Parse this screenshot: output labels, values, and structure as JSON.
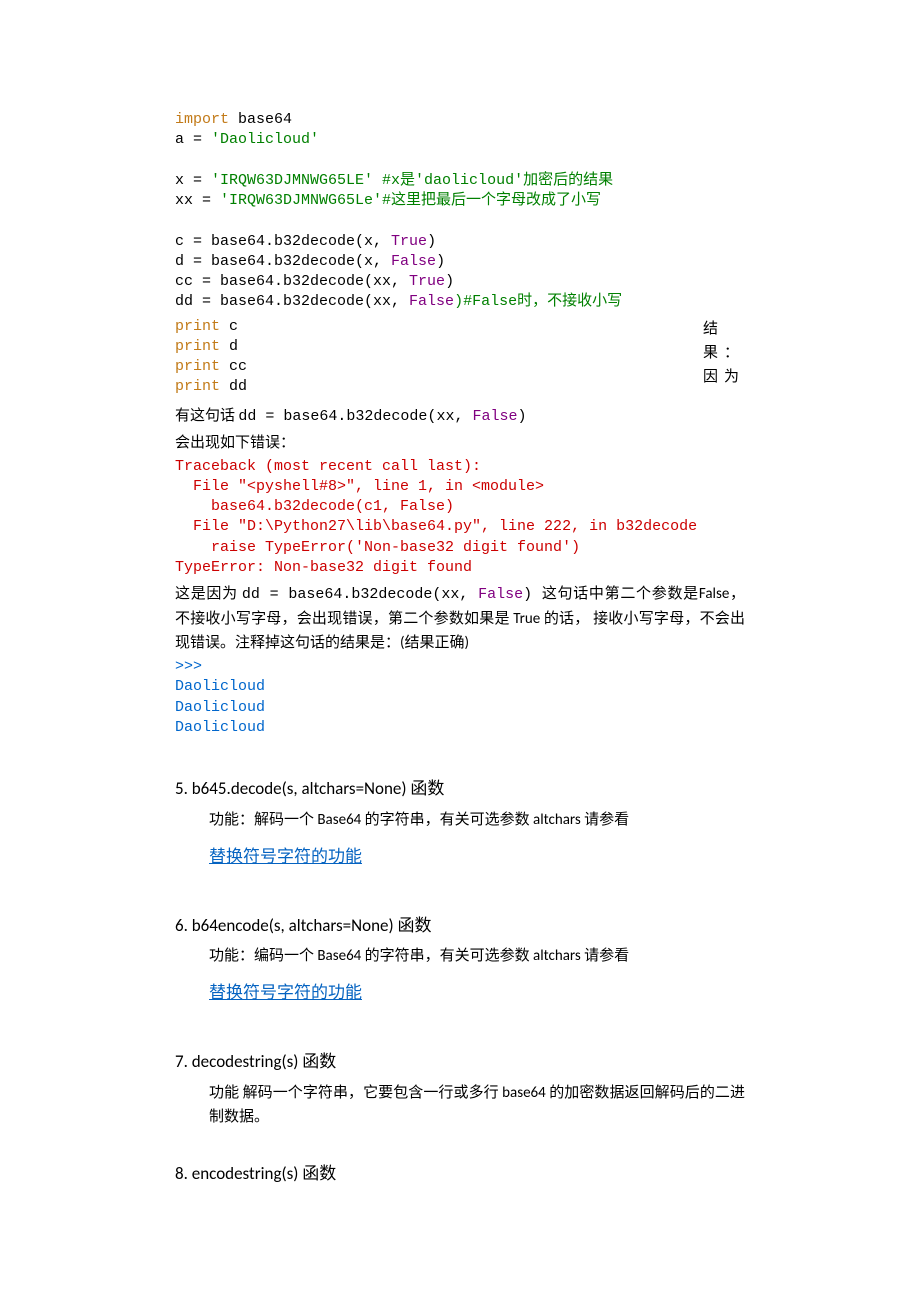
{
  "code1": {
    "l1a": "import",
    "l1b": " base64",
    "l2a": "a = ",
    "l2b": "'Daolicloud'",
    "l3a": "x = ",
    "l3b": "'IRQW63DJMNWG65LE'",
    "l3c": " #x是'daolicloud'加密后的结果",
    "l4a": "xx = ",
    "l4b": "'IRQW63DJMNWG65Le'",
    "l4c": "#这里把最后一个字母改成了小写",
    "l5a": "c = base64.b32decode(x, ",
    "l5b": "True",
    "l5c": ")",
    "l6a": "d = base64.b32decode(x, ",
    "l6b": "False",
    "l6c": ")",
    "l7a": "cc = base64.b32decode(xx, ",
    "l7b": "True",
    "l7c": ")",
    "l8a": "dd = base64.b32decode(xx, ",
    "l8b": "False",
    "l8c": ")#False时，不接收小写",
    "l9": "print",
    "l9b": " c",
    "l10": "print",
    "l10b": " d",
    "l11": "print",
    "l11b": " cc",
    "l12": "print",
    "l12b": " dd"
  },
  "side_text": "结果：因为",
  "para1a": "有这句话 ",
  "para1b": "dd = base64.b32decode(xx, ",
  "para1c": "False",
  "para1d": ")",
  "para2": "会出现如下错误：",
  "trace": {
    "l1": "Traceback (most recent call last):",
    "l2": "  File \"<pyshell#8>\", line 1, in <module>",
    "l3": "    base64.b32decode(c1, False)",
    "l4": "  File \"D:\\Python27\\lib\\base64.py\", line 222, in b32decode",
    "l5": "    raise TypeError('Non-base32 digit found')",
    "l6": "TypeError: Non-base32 digit found"
  },
  "para3a": "这是因为 ",
  "para3b": "dd = base64.b32decode(xx, ",
  "para3c": "False",
  "para3d": ") ",
  "para3e": "这句话中第二个参数是False，不接收小写字母，会出现错误，第二个参数如果是 True 的话，  接收小写字母，不会出现错误。注释掉这句话的结果是：(结果正确)",
  "out": {
    "l1": ">>>",
    "l2": "Daolicloud",
    "l3": "Daolicloud",
    "l4": "Daolicloud"
  },
  "h5": "5.  b645.decode(s, altchars=None)  函数",
  "h5_sub": "功能：解码一个 Base64 的字符串，有关可选参数 altchars 请参看",
  "link5": "替换符号字符的功能",
  "h6": "6.  b64encode(s, altchars=None)  函数",
  "h6_sub": "功能：编码一个 Base64 的字符串，有关可选参数 altchars 请参看",
  "link6": "替换符号字符的功能",
  "h7": "7.  decodestring(s)  函数",
  "h7_sub": "功能 解码一个字符串，它要包含一行或多行 base64 的加密数据返回解码后的二进制数据。",
  "h8": "8.  encodestring(s)  函数"
}
